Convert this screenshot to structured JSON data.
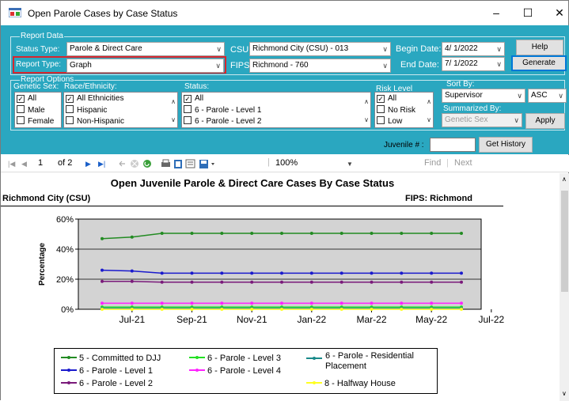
{
  "window": {
    "title": "Open Parole Cases by Case Status",
    "minimize": "–",
    "maximize": "☐",
    "close": "✕"
  },
  "report_data": {
    "group_title": "Report Data",
    "status_type_label": "Status Type:",
    "status_type_value": "Parole & Direct Care",
    "report_type_label": "Report Type:",
    "report_type_value": "Graph",
    "csu_label": "CSU:",
    "csu_value": "Richmond City (CSU) - 013",
    "fips_label": "FIPS:",
    "fips_value": "Richmond - 760",
    "begin_date_label": "Begin Date:",
    "begin_date_value": "4/ 1/2022",
    "end_date_label": "End Date:",
    "end_date_value": "7/ 1/2022",
    "help_button": "Help",
    "generate_button": "Generate"
  },
  "report_options": {
    "group_title": "Report Options",
    "genetic_sex_label": "Genetic Sex:",
    "genetic_sex_items": [
      {
        "label": "All",
        "checked": true
      },
      {
        "label": "Male",
        "checked": false
      },
      {
        "label": "Female",
        "checked": false
      }
    ],
    "race_label": "Race/Ethnicity:",
    "race_items": [
      {
        "label": "All Ethnicities",
        "checked": true
      },
      {
        "label": "Hispanic",
        "checked": false
      },
      {
        "label": "Non-Hispanic",
        "checked": false
      }
    ],
    "status_label": "Status:",
    "status_items": [
      {
        "label": "All",
        "checked": true
      },
      {
        "label": "6 - Parole - Level 1",
        "checked": false
      },
      {
        "label": "6 - Parole - Level 2",
        "checked": false
      }
    ],
    "risk_label": "Risk Level",
    "risk_items": [
      {
        "label": "All",
        "checked": true
      },
      {
        "label": "No Risk",
        "checked": false
      },
      {
        "label": "Low",
        "checked": false
      }
    ],
    "sort_by_label": "Sort By:",
    "sort_by_value": "Supervisor",
    "sort_dir_value": "ASC",
    "summarized_by_label": "Summarized By:",
    "summarized_by_value": "Genetic Sex",
    "apply_button": "Apply",
    "juvenile_label": "Juvenile # :",
    "juvenile_value": "",
    "get_history_button": "Get History"
  },
  "toolbar": {
    "first": "|◀",
    "prev": "◀",
    "page_current": "1",
    "page_of": "of 2",
    "next": "▶",
    "last": "▶|",
    "zoom": "100%",
    "find": "Find",
    "separator": "|",
    "next_find": "Next"
  },
  "report": {
    "title": "Open Juvenile Parole & Direct Care Cases By Case Status",
    "left_sub": "Richmond City (CSU)",
    "right_sub": "FIPS: Richmond"
  },
  "colors": {
    "teal_panel": "#2aa7c0",
    "highlight_red": "#d7262e",
    "plot_bg": "#d3d3d3"
  },
  "chart_data": {
    "type": "line",
    "ylabel": "Percentage",
    "xlabel": "",
    "title": "",
    "ylim": [
      0,
      60
    ],
    "y_ticks": [
      "0%",
      "20%",
      "40%",
      "60%"
    ],
    "x_tick_labels": [
      "Jul-21",
      "Sep-21",
      "Nov-21",
      "Jan-22",
      "Mar-22",
      "May-22",
      "Jul-22"
    ],
    "grid": true,
    "legend_position": "bottom",
    "series": [
      {
        "name": "5 - Committed to DJJ",
        "color": "#228b22",
        "values": [
          47,
          48,
          50.5,
          50.5,
          50.5,
          50.5,
          50.5,
          50.5,
          50.5,
          50.5,
          50.5,
          50.5,
          50.5
        ]
      },
      {
        "name": "6 - Parole - Level 1",
        "color": "#1a1acd",
        "values": [
          26,
          25.5,
          24,
          24,
          24,
          24,
          24,
          24,
          24,
          24,
          24,
          24,
          24
        ]
      },
      {
        "name": "6 - Parole - Level 2",
        "color": "#7a1a7a",
        "values": [
          18.5,
          18.5,
          18,
          18,
          18,
          18,
          18,
          18,
          18,
          18,
          18,
          18,
          18
        ]
      },
      {
        "name": "6 - Parole - Level 3",
        "color": "#22e022",
        "values": [
          1.5,
          1.5,
          1.5,
          1.5,
          1.5,
          1.5,
          1.5,
          1.5,
          1.5,
          1.5,
          1.5,
          1.5,
          1.5
        ]
      },
      {
        "name": "6 - Parole - Level 4",
        "color": "#ff22ff",
        "values": [
          4,
          4,
          4,
          4,
          4,
          4,
          4,
          4,
          4,
          4,
          4,
          4,
          4
        ]
      },
      {
        "name": "6 - Parole - Residential Placement",
        "color": "#1a8a8a",
        "values": [
          0.5,
          0.5,
          0.5,
          0.5,
          0.5,
          0.5,
          0.5,
          0.5,
          0.5,
          0.5,
          0.5,
          0.5,
          0.5
        ]
      },
      {
        "name": "8 - Halfway House",
        "color": "#ffff22",
        "values": [
          0,
          0,
          0,
          0,
          0,
          0,
          0,
          0,
          0,
          0,
          0,
          0,
          0
        ]
      }
    ]
  }
}
